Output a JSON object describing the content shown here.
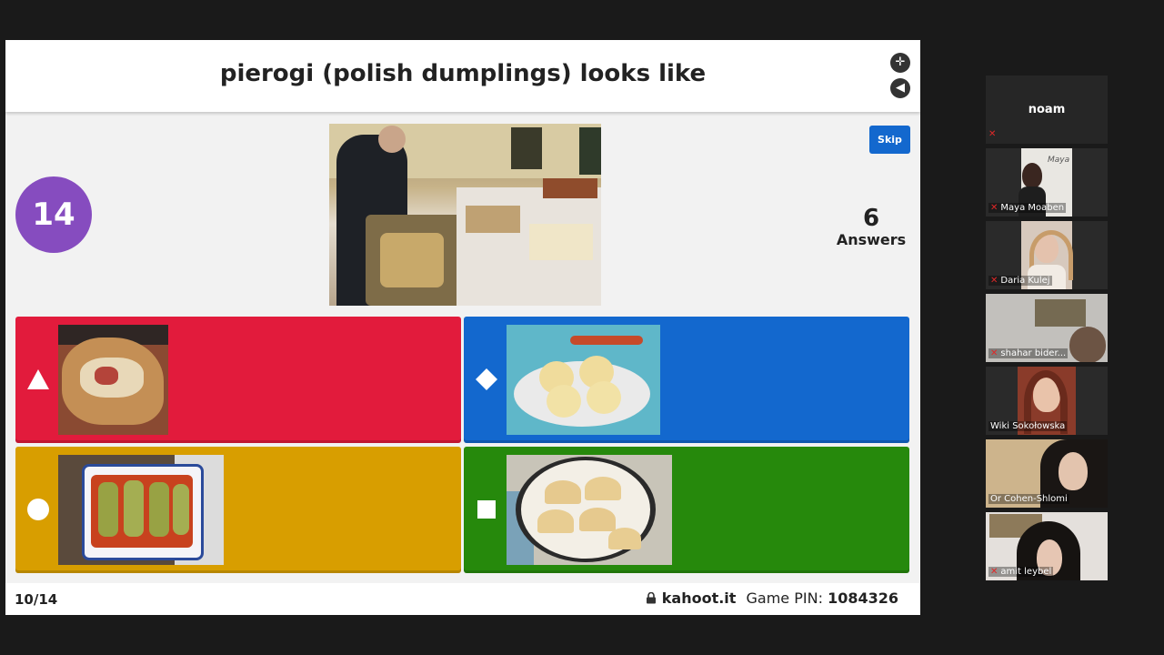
{
  "kahoot": {
    "question": "pierogi (polish dumplings) looks like",
    "timer": "14",
    "skip_label": "Skip",
    "answers_count": "6",
    "answers_label": "Answers",
    "progress": "10/14",
    "site": "kahoot.it",
    "pin_label": "Game PIN:",
    "pin": "1084326",
    "tiles": [
      {
        "shape": "triangle-icon",
        "color": "#e21b3c"
      },
      {
        "shape": "diamond-icon",
        "color": "#1368ce"
      },
      {
        "shape": "circle-icon",
        "color": "#d89e00"
      },
      {
        "shape": "square-icon",
        "color": "#26890c"
      }
    ]
  },
  "participants": [
    {
      "name": "noam",
      "muted": true
    },
    {
      "name": "Maya Moaben",
      "muted": true
    },
    {
      "name": "Daria Kulej",
      "muted": true
    },
    {
      "name": "shahar bider...",
      "muted": true
    },
    {
      "name": "Wiki Sokołowska",
      "muted": false
    },
    {
      "name": "Or Cohen-Shlomi",
      "muted": false
    },
    {
      "name": "amit leybel",
      "muted": true
    }
  ]
}
